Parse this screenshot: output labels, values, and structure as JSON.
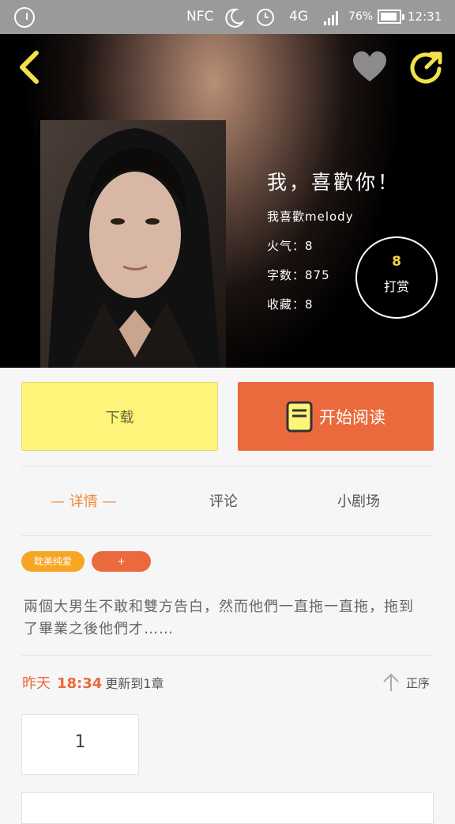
{
  "status_bar": {
    "nfc": "NFC",
    "network": "4G",
    "battery": "76%",
    "time": "12:31"
  },
  "book": {
    "title": "我，喜歡你！",
    "author": "我喜歡melody",
    "popularity_label": "火气：",
    "popularity": "8",
    "wordcount_label": "字数：",
    "wordcount": "875",
    "favorites_label": "收藏：",
    "favorites": "8"
  },
  "reward": {
    "count": "8",
    "label": "打赏"
  },
  "actions": {
    "download_label": "下载",
    "read_label": "开始阅读"
  },
  "tabs": [
    {
      "label": "— 详情 —"
    },
    {
      "label": "评论"
    },
    {
      "label": "小剧场"
    }
  ],
  "tags": [
    {
      "label": "耽美纯爱",
      "color": "#f5a623"
    },
    {
      "label": "+",
      "color": "#eb6a3d"
    }
  ],
  "description": "兩個大男生不敢和雙方告白，然而他們一直拖一直拖，拖到了畢業之後他們才……",
  "update": {
    "day": "昨天",
    "time": "18:34",
    "text": "更新到1章"
  },
  "sort_label": "正序",
  "chapter_label": "1",
  "colors": {
    "accent": "#eb6a3d",
    "yellow_button": "#fdf479",
    "active_tab": "#f0893e"
  }
}
